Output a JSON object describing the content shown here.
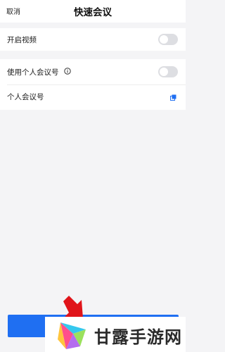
{
  "header": {
    "cancel_label": "取消",
    "title": "快速会议"
  },
  "settings": {
    "video": {
      "label": "开启视频",
      "enabled": false
    },
    "personal_id": {
      "label": "使用个人会议号",
      "enabled": false
    },
    "personal_id_number": {
      "label": "个人会议号"
    }
  },
  "footer": {
    "start_button_label": ""
  },
  "watermark": {
    "text": "甘露手游网"
  },
  "colors": {
    "accent": "#1f6ff2",
    "toggle_off": "#dddee2",
    "arrow": "#e0141a"
  }
}
